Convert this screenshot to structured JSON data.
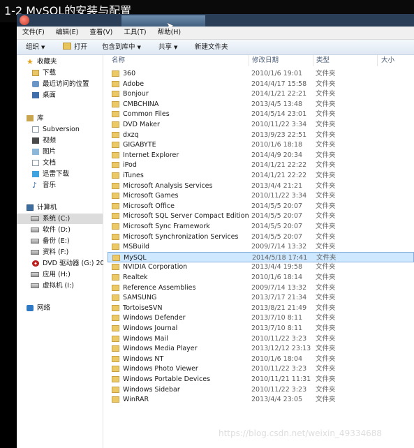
{
  "video_title": "1-2 MySQL的安装与配置",
  "menu": [
    "文件(F)",
    "编辑(E)",
    "查看(V)",
    "工具(T)",
    "帮助(H)"
  ],
  "toolbar": {
    "organize": "组织",
    "open": "打开",
    "include_in_library": "包含到库中",
    "share": "共享",
    "new_folder": "新建文件夹"
  },
  "nav": {
    "favorites": {
      "label": "收藏夹",
      "items": [
        "下载",
        "最近访问的位置",
        "桌面"
      ]
    },
    "libraries": {
      "label": "库",
      "items": [
        "Subversion",
        "视频",
        "图片",
        "文档",
        "迅雷下载",
        "音乐"
      ]
    },
    "computer": {
      "label": "计算机",
      "items": [
        "系统 (C:)",
        "软件 (D:)",
        "备份 (E:)",
        "资料 (F:)",
        "DVD 驱动器 (G:) 20",
        "应用 (H:)",
        "虚拟机 (I:)"
      ]
    },
    "network": {
      "label": "网络"
    }
  },
  "columns": {
    "name": "名称",
    "date": "修改日期",
    "type": "类型",
    "size": "大小"
  },
  "files": [
    {
      "name": "360",
      "date": "2010/1/6 19:01",
      "type": "文件夹"
    },
    {
      "name": "Adobe",
      "date": "2014/4/17 15:58",
      "type": "文件夹"
    },
    {
      "name": "Bonjour",
      "date": "2014/1/21 22:21",
      "type": "文件夹"
    },
    {
      "name": "CMBCHINA",
      "date": "2013/4/5 13:48",
      "type": "文件夹"
    },
    {
      "name": "Common Files",
      "date": "2014/5/14 23:01",
      "type": "文件夹"
    },
    {
      "name": "DVD Maker",
      "date": "2010/11/22 3:34",
      "type": "文件夹"
    },
    {
      "name": "dxzq",
      "date": "2013/9/23 22:51",
      "type": "文件夹"
    },
    {
      "name": "GIGABYTE",
      "date": "2010/1/6 18:18",
      "type": "文件夹"
    },
    {
      "name": "Internet Explorer",
      "date": "2014/4/9 20:34",
      "type": "文件夹"
    },
    {
      "name": "iPod",
      "date": "2014/1/21 22:22",
      "type": "文件夹"
    },
    {
      "name": "iTunes",
      "date": "2014/1/21 22:22",
      "type": "文件夹"
    },
    {
      "name": "Microsoft Analysis Services",
      "date": "2013/4/4 21:21",
      "type": "文件夹"
    },
    {
      "name": "Microsoft Games",
      "date": "2010/11/22 3:34",
      "type": "文件夹"
    },
    {
      "name": "Microsoft Office",
      "date": "2014/5/5 20:07",
      "type": "文件夹"
    },
    {
      "name": "Microsoft SQL Server Compact Edition",
      "date": "2014/5/5 20:07",
      "type": "文件夹"
    },
    {
      "name": "Microsoft Sync Framework",
      "date": "2014/5/5 20:07",
      "type": "文件夹"
    },
    {
      "name": "Microsoft Synchronization Services",
      "date": "2014/5/5 20:07",
      "type": "文件夹"
    },
    {
      "name": "MSBuild",
      "date": "2009/7/14 13:32",
      "type": "文件夹"
    },
    {
      "name": "MySQL",
      "date": "2014/5/18 17:41",
      "type": "文件夹",
      "selected": true
    },
    {
      "name": "NVIDIA Corporation",
      "date": "2013/4/4 19:58",
      "type": "文件夹"
    },
    {
      "name": "Realtek",
      "date": "2010/1/6 18:14",
      "type": "文件夹"
    },
    {
      "name": "Reference Assemblies",
      "date": "2009/7/14 13:32",
      "type": "文件夹"
    },
    {
      "name": "SAMSUNG",
      "date": "2013/7/17 21:34",
      "type": "文件夹"
    },
    {
      "name": "TortoiseSVN",
      "date": "2013/8/21 21:49",
      "type": "文件夹"
    },
    {
      "name": "Windows Defender",
      "date": "2013/7/10 8:11",
      "type": "文件夹"
    },
    {
      "name": "Windows Journal",
      "date": "2013/7/10 8:11",
      "type": "文件夹"
    },
    {
      "name": "Windows Mail",
      "date": "2010/11/22 3:23",
      "type": "文件夹"
    },
    {
      "name": "Windows Media Player",
      "date": "2013/12/12 23:13",
      "type": "文件夹"
    },
    {
      "name": "Windows NT",
      "date": "2010/1/6 18:04",
      "type": "文件夹"
    },
    {
      "name": "Windows Photo Viewer",
      "date": "2010/11/22 3:23",
      "type": "文件夹"
    },
    {
      "name": "Windows Portable Devices",
      "date": "2010/11/21 11:31",
      "type": "文件夹"
    },
    {
      "name": "Windows Sidebar",
      "date": "2010/11/22 3:23",
      "type": "文件夹"
    },
    {
      "name": "WinRAR",
      "date": "2013/4/4 23:05",
      "type": "文件夹"
    }
  ],
  "watermark": "https://blog.csdn.net/weixin_49334688",
  "colors": {
    "selection": "#cde8ff",
    "selection_border": "#84acdd",
    "folder": "#ecc967"
  }
}
